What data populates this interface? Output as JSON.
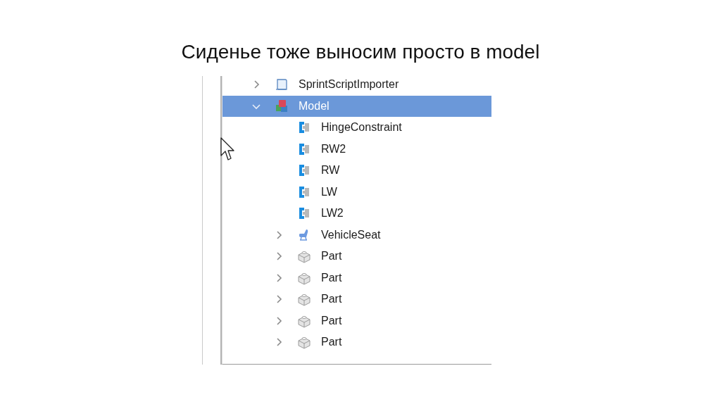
{
  "title": "Сиденье тоже выносим просто в model",
  "explorer": {
    "items": [
      {
        "label": "SprintScriptImporter",
        "kind": "script",
        "expanded": false,
        "selected": false
      },
      {
        "label": "Model",
        "kind": "model",
        "expanded": true,
        "selected": true,
        "children": [
          {
            "label": "HingeConstraint",
            "kind": "constraint",
            "selected": false
          },
          {
            "label": "RW2",
            "kind": "constraint",
            "selected": false
          },
          {
            "label": "RW",
            "kind": "constraint",
            "selected": false
          },
          {
            "label": "LW",
            "kind": "constraint",
            "selected": false
          },
          {
            "label": "LW2",
            "kind": "constraint",
            "selected": false
          },
          {
            "label": "VehicleSeat",
            "kind": "seat",
            "expanded": false,
            "selected": false
          },
          {
            "label": "Part",
            "kind": "part",
            "expanded": false,
            "selected": false
          },
          {
            "label": "Part",
            "kind": "part",
            "expanded": false,
            "selected": false
          },
          {
            "label": "Part",
            "kind": "part",
            "expanded": false,
            "selected": false
          },
          {
            "label": "Part",
            "kind": "part",
            "expanded": false,
            "selected": false
          },
          {
            "label": "Part",
            "kind": "part",
            "expanded": false,
            "selected": false
          }
        ]
      }
    ]
  }
}
